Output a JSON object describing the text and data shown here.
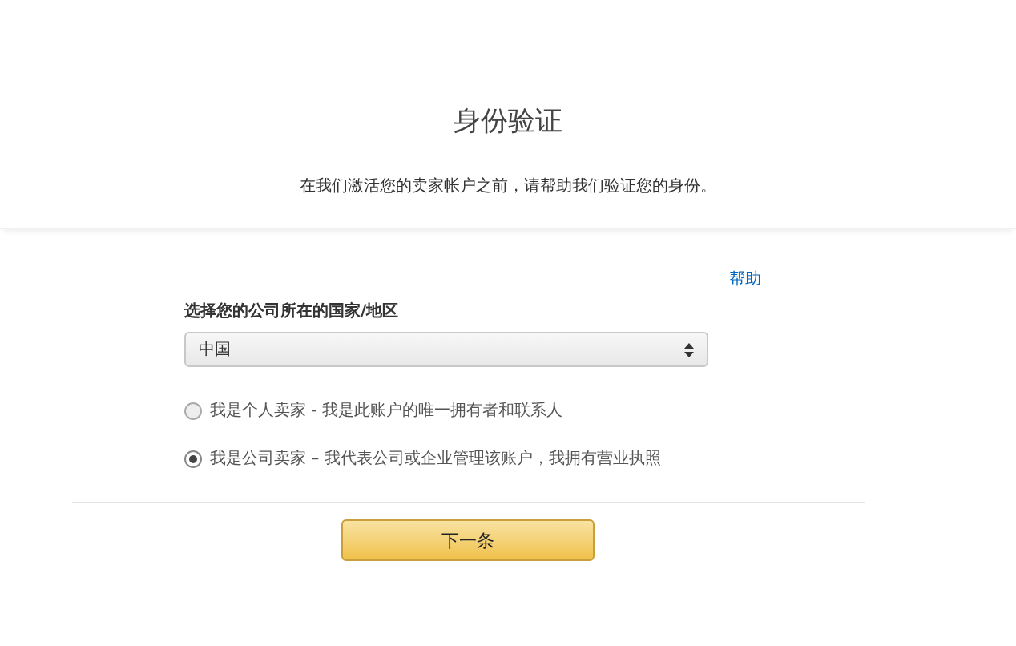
{
  "header": {
    "title": "身份验证",
    "subtitle": "在我们激活您的卖家帐户之前，请帮助我们验证您的身份。"
  },
  "help_link": "帮助",
  "country": {
    "label": "选择您的公司所在的国家/地区",
    "value": "中国"
  },
  "seller_types": [
    {
      "label": "我是个人卖家 - 我是此账户的唯一拥有者和联系人",
      "selected": false
    },
    {
      "label": "我是公司卖家 – 我代表公司或企业管理该账户，我拥有营业执照",
      "selected": true
    }
  ],
  "next_button": "下一条"
}
